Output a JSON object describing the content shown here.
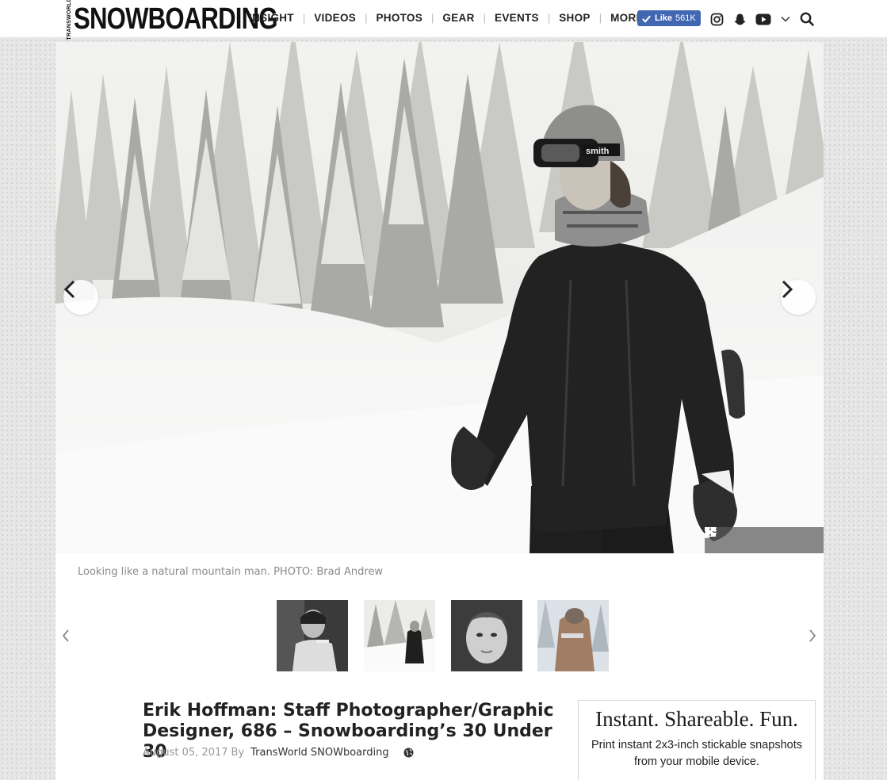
{
  "brand": {
    "small": "TRANSWORLD",
    "big": "SNOWBOARDING"
  },
  "nav": {
    "items": [
      "INSIGHT",
      "VIDEOS",
      "PHOTOS",
      "GEAR",
      "EVENTS",
      "SHOP",
      "MORE"
    ],
    "separator": "|"
  },
  "facebook": {
    "label": "Like",
    "count": "561K",
    "color": "#4267b2"
  },
  "social": {
    "icons": [
      "instagram-icon",
      "snapchat-icon",
      "youtube-icon",
      "chevron-down-icon",
      "search-icon"
    ]
  },
  "gallery": {
    "caption": "Looking like a natural mountain man. PHOTO: Brad Andrew",
    "controls": [
      "play-icon",
      "grid-icon",
      "text-icon",
      "fullscreen-icon"
    ],
    "thumbnails": [
      "thumb-1",
      "thumb-2",
      "thumb-3",
      "thumb-4"
    ]
  },
  "article": {
    "title": "Erik Hoffman: Staff Photographer/Graphic Designer, 686 – Snowboarding’s 30 Under 30",
    "date": "August 05, 2017",
    "by": "By",
    "author": "TransWorld SNOWboarding"
  },
  "ad": {
    "headline": "Instant. Shareable. Fun.",
    "body": "Print instant 2x3-inch stickable snapshots from your mobile device."
  }
}
